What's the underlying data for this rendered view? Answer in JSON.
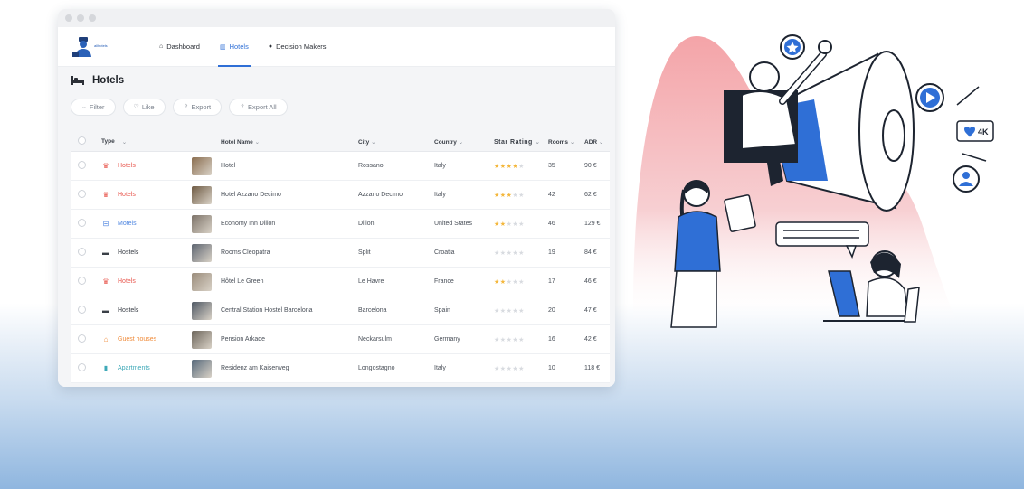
{
  "colors": {
    "accent": "#2f6fd6",
    "hotel": "#e8584f",
    "motel": "#4f86e0",
    "hostel": "#3a3f47",
    "guest": "#f08b3a",
    "apartment": "#3fa9b8",
    "star": "#f4b73c"
  },
  "logo": {
    "text": "allhotels"
  },
  "nav": [
    {
      "label": "Dashboard",
      "icon": "home-icon"
    },
    {
      "label": "Hotels",
      "icon": "building-icon",
      "active": true
    },
    {
      "label": "Decision Makers",
      "icon": "person-icon"
    }
  ],
  "page": {
    "title": "Hotels",
    "icon": "bed-icon"
  },
  "toolbar": {
    "filter_label": "Filter",
    "like_label": "Like",
    "export_label": "Export",
    "export_all_label": "Export All"
  },
  "columns": {
    "type": "Type",
    "hotel_name": "Hotel Name",
    "city": "City",
    "country": "Country",
    "star_rating": "Star Rating",
    "rooms": "Rooms",
    "adr": "ADR"
  },
  "rows": [
    {
      "type": "Hotels",
      "type_kind": "hotel",
      "name": "Hotel",
      "city": "Rossano",
      "country": "Italy",
      "stars": 4,
      "rooms": "35",
      "adr": "90 €"
    },
    {
      "type": "Hotels",
      "type_kind": "hotel",
      "name": "Hotel Azzano Decimo",
      "city": "Azzano Decimo",
      "country": "Italy",
      "stars": 3,
      "rooms": "42",
      "adr": "62 €"
    },
    {
      "type": "Motels",
      "type_kind": "motel",
      "name": "Economy Inn Dillon",
      "city": "Dillon",
      "country": "United States",
      "stars": 2,
      "rooms": "46",
      "adr": "129 €"
    },
    {
      "type": "Hostels",
      "type_kind": "hostel",
      "name": "Rooms Cleopatra",
      "city": "Split",
      "country": "Croatia",
      "stars": 0,
      "rooms": "19",
      "adr": "84 €"
    },
    {
      "type": "Hotels",
      "type_kind": "hotel",
      "name": "Hôtel Le Green",
      "city": "Le Havre",
      "country": "France",
      "stars": 2,
      "rooms": "17",
      "adr": "46 €"
    },
    {
      "type": "Hostels",
      "type_kind": "hostel",
      "name": "Central Station Hostel Barcelona",
      "city": "Barcelona",
      "country": "Spain",
      "stars": 0,
      "rooms": "20",
      "adr": "47 €"
    },
    {
      "type": "Guest houses",
      "type_kind": "guest",
      "name": "Pension Arkade",
      "city": "Neckarsulm",
      "country": "Germany",
      "stars": 0,
      "rooms": "16",
      "adr": "42 €"
    },
    {
      "type": "Apartments",
      "type_kind": "apartment",
      "name": "Residenz am Kaiserweg",
      "city": "Longostagno",
      "country": "Italy",
      "stars": 0,
      "rooms": "10",
      "adr": "118 €"
    }
  ],
  "hero": {
    "badge_text": "4K"
  }
}
